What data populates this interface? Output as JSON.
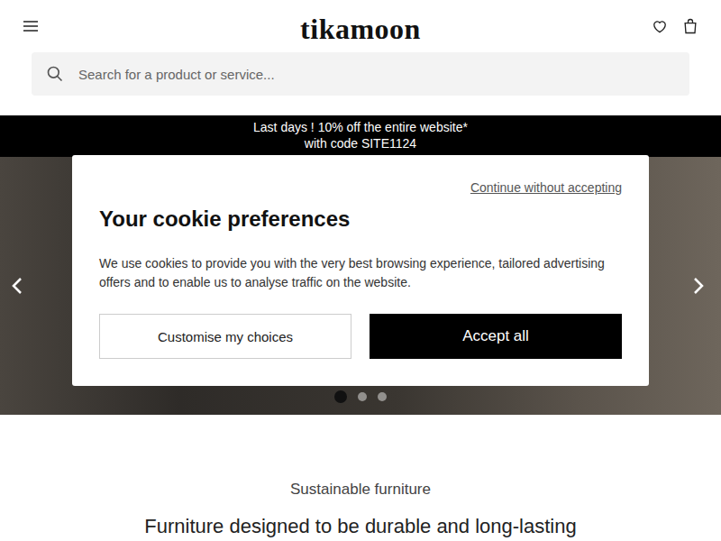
{
  "header": {
    "logo": "tikamoon"
  },
  "search": {
    "placeholder": "Search for a product or service..."
  },
  "promo": {
    "lines": [
      "Last days ! 10% off the entire website*",
      "with code SITE1124"
    ]
  },
  "carousel": {
    "dots": [
      {
        "selected": true
      },
      {
        "selected": false
      },
      {
        "selected": false
      }
    ]
  },
  "cookie_dialog": {
    "skip_link": "Continue without accepting",
    "title": "Your cookie preferences",
    "body": "We use cookies to provide you with the very best browsing experience, tailored advertising offers and to enable us to analyse traffic on the website.",
    "buttons": [
      {
        "label": "Customise my choices",
        "kind": "outline"
      },
      {
        "label": "Accept all",
        "kind": "solid"
      }
    ]
  },
  "section": {
    "eyebrow": "Sustainable furniture",
    "heading": "Furniture designed to be durable and long-lasting"
  }
}
